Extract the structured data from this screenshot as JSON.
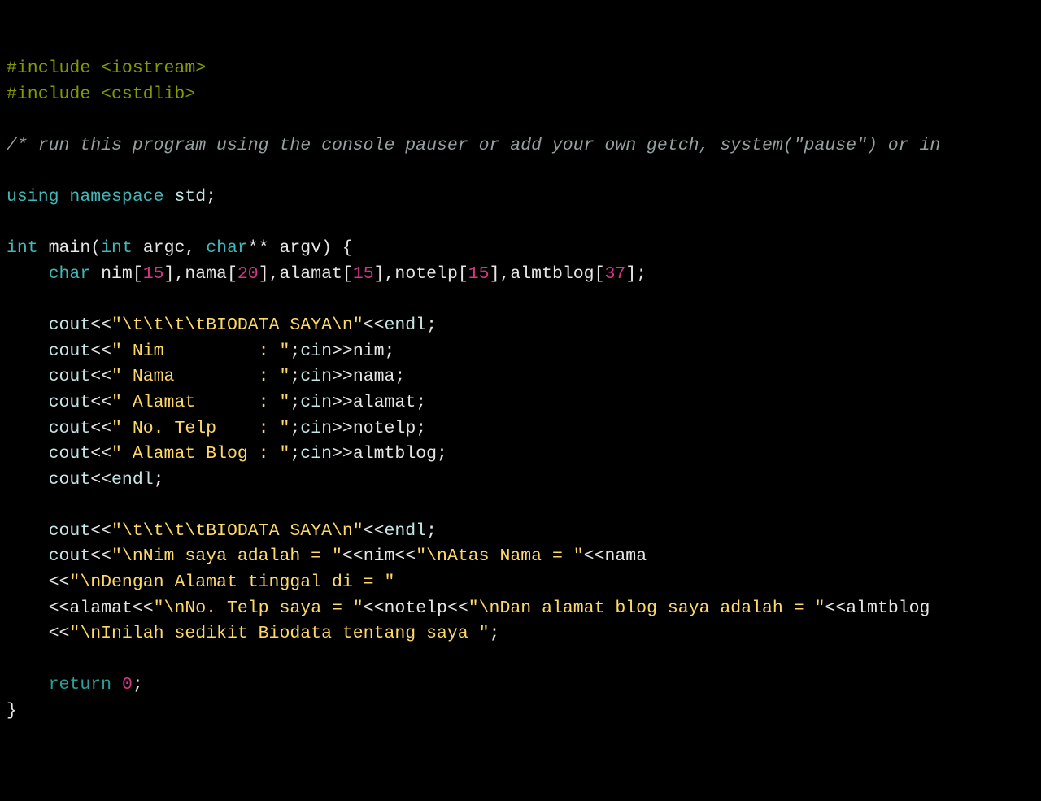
{
  "lines": {
    "l1a": "#include",
    "l1b": " <iostream>",
    "l2a": "#include",
    "l2b": " <cstdlib>",
    "l3": "",
    "l4": "/* run this program using the console pauser or add your own getch, system(\"pause\") or in",
    "l5": "",
    "l6a": "using",
    "l6b": " namespace",
    "l6c": " std",
    "l6d": ";",
    "l7": "",
    "l8a": "int",
    "l8b": " main(",
    "l8c": "int",
    "l8d": " argc, ",
    "l8e": "char",
    "l8f": "** argv) {",
    "l9a": "    char",
    "l9b": " nim[",
    "l9c": "15",
    "l9d": "],nama[",
    "l9e": "20",
    "l9f": "],alamat[",
    "l9g": "15",
    "l9h": "],notelp[",
    "l9i": "15",
    "l9j": "],almtblog[",
    "l9k": "37",
    "l9l": "];",
    "l10": "",
    "l11a": "    cout",
    "l11b": "<<",
    "l11c": "\"\\t\\t\\t\\tBIODATA SAYA\\n\"",
    "l11d": "<<",
    "l11e": "endl",
    "l11f": ";",
    "l12a": "    cout",
    "l12b": "<<",
    "l12c": "\" Nim         : \"",
    "l12d": ";",
    "l12e": "cin",
    "l12f": ">>",
    "l12g": "nim;",
    "l13a": "    cout",
    "l13b": "<<",
    "l13c": "\" Nama        : \"",
    "l13d": ";",
    "l13e": "cin",
    "l13f": ">>",
    "l13g": "nama;",
    "l14a": "    cout",
    "l14b": "<<",
    "l14c": "\" Alamat      : \"",
    "l14d": ";",
    "l14e": "cin",
    "l14f": ">>",
    "l14g": "alamat;",
    "l15a": "    cout",
    "l15b": "<<",
    "l15c": "\" No. Telp    : \"",
    "l15d": ";",
    "l15e": "cin",
    "l15f": ">>",
    "l15g": "notelp;",
    "l16a": "    cout",
    "l16b": "<<",
    "l16c": "\" Alamat Blog : \"",
    "l16d": ";",
    "l16e": "cin",
    "l16f": ">>",
    "l16g": "almtblog;",
    "l17a": "    cout",
    "l17b": "<<",
    "l17c": "endl",
    "l17d": ";",
    "l18": "",
    "l19a": "    cout",
    "l19b": "<<",
    "l19c": "\"\\t\\t\\t\\tBIODATA SAYA\\n\"",
    "l19d": "<<",
    "l19e": "endl",
    "l19f": ";",
    "l20a": "    cout",
    "l20b": "<<",
    "l20c": "\"\\nNim saya adalah = \"",
    "l20d": "<<",
    "l20e": "nim",
    "l20f": "<<",
    "l20g": "\"\\nAtas Nama = \"",
    "l20h": "<<",
    "l20i": "nama",
    "l21a": "    <<",
    "l21b": "\"\\nDengan Alamat tinggal di = \"",
    "l22a": "    <<",
    "l22b": "alamat",
    "l22c": "<<",
    "l22d": "\"\\nNo. Telp saya = \"",
    "l22e": "<<",
    "l22f": "notelp",
    "l22g": "<<",
    "l22h": "\"\\nDan alamat blog saya adalah = \"",
    "l22i": "<<",
    "l22j": "almtblog",
    "l23a": "    <<",
    "l23b": "\"\\nInilah sedikit Biodata tentang saya \"",
    "l23c": ";",
    "l24": "",
    "l25a": "    return",
    "l25b": " ",
    "l25c": "0",
    "l25d": ";",
    "l26": "}"
  }
}
